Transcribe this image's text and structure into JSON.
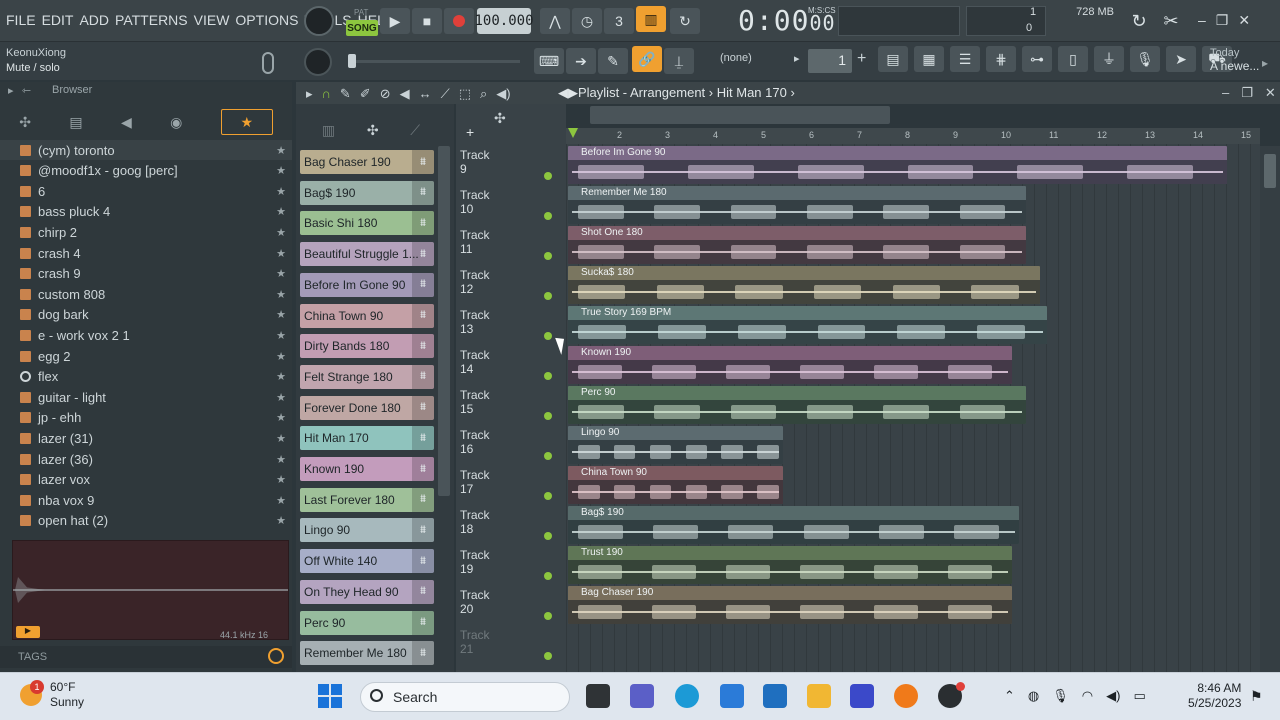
{
  "menu": [
    "FILE",
    "EDIT",
    "ADD",
    "PATTERNS",
    "VIEW",
    "OPTIONS",
    "TOOLS",
    "HELP"
  ],
  "transport": {
    "pat_label": "PAT",
    "song_label": "SONG",
    "tempo": "100.000",
    "time": "0:00",
    "time_sub": "00",
    "time_format": "M:S:CS"
  },
  "memory": {
    "cpu": "1",
    "mem": "728 MB",
    "voices": "0"
  },
  "hint": {
    "user": "KeonuXiong",
    "text": "Mute / solo"
  },
  "toolbar2": {
    "pattern_selector": "(none)",
    "pattern_number": "1",
    "news_title": "Today",
    "news_text": "A newe..."
  },
  "browser": {
    "title": "Browser",
    "items": [
      {
        "label": "(cym) toronto",
        "type": "folder"
      },
      {
        "label": "@moodf1x - goog [perc]",
        "type": "folder"
      },
      {
        "label": "6",
        "type": "folder"
      },
      {
        "label": "bass pluck 4",
        "type": "folder"
      },
      {
        "label": "chirp 2",
        "type": "folder"
      },
      {
        "label": "crash 4",
        "type": "folder"
      },
      {
        "label": "crash 9",
        "type": "folder"
      },
      {
        "label": "custom 808",
        "type": "folder"
      },
      {
        "label": "dog bark",
        "type": "folder"
      },
      {
        "label": "e - work vox 2 1",
        "type": "folder"
      },
      {
        "label": "egg 2",
        "type": "folder"
      },
      {
        "label": "flex",
        "type": "gear"
      },
      {
        "label": "guitar - light",
        "type": "folder"
      },
      {
        "label": "jp - ehh",
        "type": "folder"
      },
      {
        "label": "lazer  (31)",
        "type": "folder"
      },
      {
        "label": "lazer  (36)",
        "type": "folder"
      },
      {
        "label": "lazer vox",
        "type": "folder"
      },
      {
        "label": "nba vox 9",
        "type": "folder"
      },
      {
        "label": "open hat (2)",
        "type": "folder"
      }
    ],
    "sample_info": "44.1 kHz 16",
    "tags_label": "TAGS"
  },
  "playlist": {
    "title": "Playlist - Arrangement",
    "arrangement": "Hit Man 170",
    "ruler": [
      "2",
      "3",
      "4",
      "5",
      "6",
      "7",
      "8",
      "9",
      "10",
      "11",
      "12",
      "13",
      "14",
      "15"
    ],
    "picker": [
      {
        "label": "Bag Chaser 190",
        "color": "#b9ad8f"
      },
      {
        "label": "Bag$ 190",
        "color": "#9ab0a8"
      },
      {
        "label": "Basic Shi 180",
        "color": "#9bbf92"
      },
      {
        "label": "Beautiful Struggle 1...",
        "color": "#b5a3bd"
      },
      {
        "label": "Before Im Gone 90",
        "color": "#a39ab8"
      },
      {
        "label": "China Town 90",
        "color": "#c4a0a6"
      },
      {
        "label": "Dirty Bands 180",
        "color": "#c29db3"
      },
      {
        "label": "Felt Strange 180",
        "color": "#c1a5ae"
      },
      {
        "label": "Forever Done 180",
        "color": "#bfa7a4"
      },
      {
        "label": "Hit Man 170",
        "color": "#8fc3bd"
      },
      {
        "label": "Known 190",
        "color": "#c39cbc"
      },
      {
        "label": "Last Forever 180",
        "color": "#9fc099"
      },
      {
        "label": "Lingo 90",
        "color": "#a7b9bd"
      },
      {
        "label": "Off White 140",
        "color": "#a7aec8"
      },
      {
        "label": "On They Head 90",
        "color": "#b4a4c0"
      },
      {
        "label": "Perc 90",
        "color": "#97bc9e"
      },
      {
        "label": "Remember Me 180",
        "color": "#a6afb3"
      }
    ],
    "tracks": [
      "Track 9",
      "Track 10",
      "Track 11",
      "Track 12",
      "Track 13",
      "Track 14",
      "Track 15",
      "Track 16",
      "Track 17",
      "Track 18",
      "Track 19",
      "Track 20",
      "Track 21"
    ],
    "clips": [
      {
        "label": "Before Im Gone 90",
        "color": "#7b6a87",
        "wave": "#d7c6dc",
        "length": 0.95
      },
      {
        "label": "Remember Me 180",
        "color": "#5b6a6f",
        "wave": "#c8d4d6",
        "length": 0.66
      },
      {
        "label": "Shot One 180",
        "color": "#7d5d69",
        "wave": "#d7c3ca",
        "length": 0.66
      },
      {
        "label": "Sucka$ 180",
        "color": "#7a7660",
        "wave": "#e3dcc0",
        "length": 0.68
      },
      {
        "label": "True Story 169 BPM",
        "color": "#5d7775",
        "wave": "#c6dcda",
        "length": 0.69
      },
      {
        "label": "Known 190",
        "color": "#7e5e78",
        "wave": "#ddc3d8",
        "length": 0.64
      },
      {
        "label": "Perc 90",
        "color": "#5a7860",
        "wave": "#c9ddc9",
        "length": 0.66
      },
      {
        "label": "Lingo 90",
        "color": "#5c6b70",
        "wave": "#d0dadc",
        "length": 0.31
      },
      {
        "label": "China Town 90",
        "color": "#7d5a60",
        "wave": "#e1c7cb",
        "length": 0.31
      },
      {
        "label": "Bag$ 190",
        "color": "#566a6a",
        "wave": "#c8d6d5",
        "length": 0.65
      },
      {
        "label": "Trust 190",
        "color": "#5f7656",
        "wave": "#cddcc5",
        "length": 0.64
      },
      {
        "label": "Bag Chaser 190",
        "color": "#786e5c",
        "wave": "#e0d7c2",
        "length": 0.64
      }
    ]
  },
  "taskbar": {
    "weather_temp": "60°F",
    "weather_desc": "Sunny",
    "weather_badge": "1",
    "search_placeholder": "Search",
    "time": "8:46 AM",
    "date": "5/25/2023"
  },
  "colors": {
    "accent": "#8dc63f",
    "highlight": "#f0a030",
    "record": "#e0403a",
    "window_bg": "#2c363b"
  }
}
